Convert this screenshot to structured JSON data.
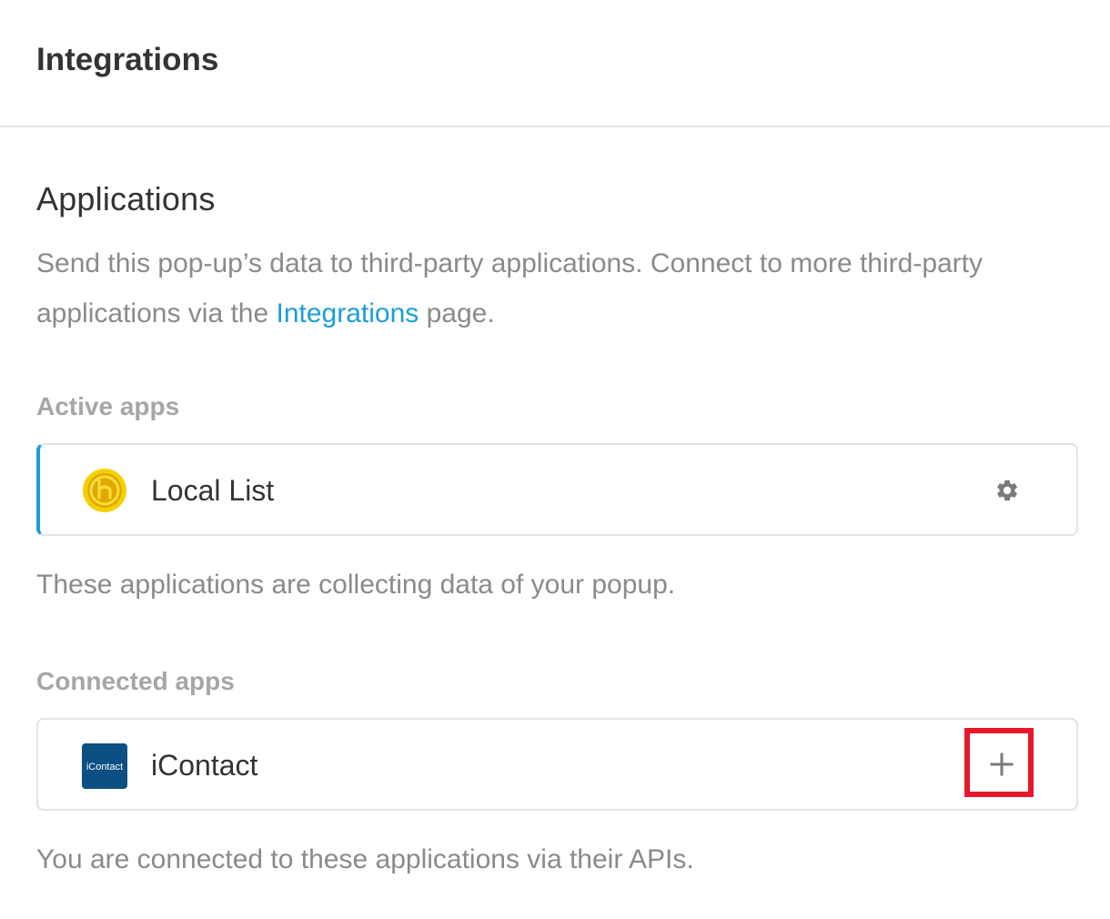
{
  "header": {
    "title": "Integrations"
  },
  "applications": {
    "title": "Applications",
    "description_before": "Send this pop-up’s data to third-party applications. Connect to more third-party applications via the ",
    "description_link": "Integrations",
    "description_after": " page."
  },
  "active_apps": {
    "label": "Active apps",
    "items": [
      {
        "name": "Local List",
        "icon": "local-list-logo",
        "action_icon": "gear-icon"
      }
    ],
    "note": "These applications are collecting data of your popup."
  },
  "connected_apps": {
    "label": "Connected apps",
    "items": [
      {
        "name": "iContact",
        "icon": "icontact-logo",
        "logo_text": "iContact",
        "action_icon": "plus-icon"
      }
    ],
    "note": "You are connected to these applications via their APIs."
  },
  "colors": {
    "accent": "#1a9ed8",
    "highlight": "#e8182a",
    "muted_text": "#8a8a8a",
    "icontact_brand": "#0b4f83",
    "local_list_brand": "#f2c200"
  }
}
